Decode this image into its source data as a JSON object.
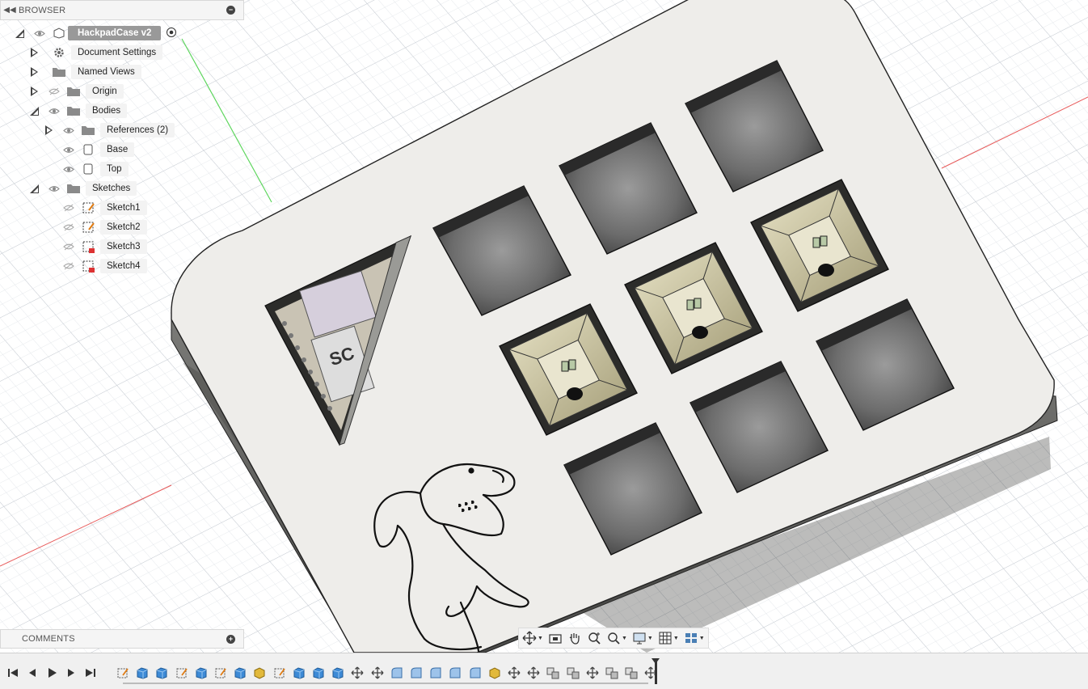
{
  "browser": {
    "title": "BROWSER",
    "root_label": "HackpadCase v2",
    "items": [
      {
        "label": "Document Settings"
      },
      {
        "label": "Named Views"
      },
      {
        "label": "Origin"
      },
      {
        "label": "Bodies"
      },
      {
        "label": "References (2)"
      },
      {
        "label": "Base"
      },
      {
        "label": "Top"
      },
      {
        "label": "Sketches"
      },
      {
        "label": "Sketch1"
      },
      {
        "label": "Sketch2"
      },
      {
        "label": "Sketch3"
      },
      {
        "label": "Sketch4"
      }
    ]
  },
  "comments": {
    "title": "COMMENTS"
  },
  "icons": {
    "eye": "eye-icon",
    "eye_hidden": "eye-hidden-icon",
    "folder": "folder-icon",
    "gear": "gear-icon",
    "body": "body-icon",
    "sketch": "sketch-icon"
  },
  "colors": {
    "grid": "#dfe3e8",
    "case_top": "#eeedea",
    "case_side": "#5a5a58",
    "switch": "#cfc8a4",
    "x_axis": "#e85a5a",
    "y_axis": "#5ed65e"
  },
  "timeline": {
    "features": [
      "sketch",
      "extrude",
      "extrude",
      "sketch",
      "extrude",
      "sketch",
      "extrude",
      "component",
      "sketch",
      "extrude",
      "extrude",
      "extrude",
      "move",
      "move",
      "fillet",
      "fillet",
      "fillet",
      "fillet",
      "fillet",
      "component",
      "move",
      "move",
      "combine",
      "combine",
      "move",
      "combine",
      "combine",
      "move"
    ]
  }
}
